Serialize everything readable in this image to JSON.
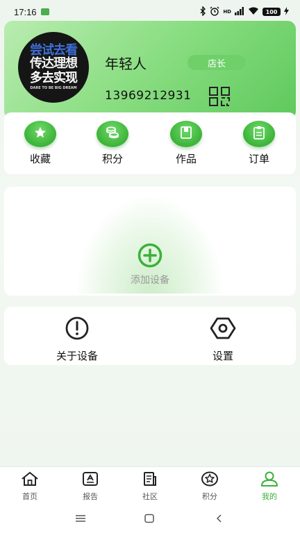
{
  "status_bar": {
    "time": "17:16",
    "network_label": "HD",
    "battery": "100"
  },
  "profile": {
    "avatar_lines": [
      "尝试去看",
      "传达理想",
      "多去实现",
      "DARE TO BE BIG DREAM"
    ],
    "username": "年轻人",
    "role": "店长",
    "phone": "13969212931"
  },
  "quick_actions": [
    {
      "label": "收藏",
      "icon": "star-icon"
    },
    {
      "label": "积分",
      "icon": "coins-icon"
    },
    {
      "label": "作品",
      "icon": "book-icon"
    },
    {
      "label": "订单",
      "icon": "clipboard-icon"
    }
  ],
  "device": {
    "add_label": "添加设备",
    "icon": "plus-circle-icon"
  },
  "tools": [
    {
      "label": "关于设备",
      "icon": "info-icon"
    },
    {
      "label": "设置",
      "icon": "gear-icon"
    }
  ],
  "bottom_nav": [
    {
      "label": "首页",
      "icon": "home-icon",
      "active": false
    },
    {
      "label": "报告",
      "icon": "report-icon",
      "active": false
    },
    {
      "label": "社区",
      "icon": "community-icon",
      "active": false
    },
    {
      "label": "积分",
      "icon": "points-icon",
      "active": false
    },
    {
      "label": "我的",
      "icon": "user-icon",
      "active": true
    }
  ],
  "colors": {
    "accent": "#3bb03a",
    "card_gradient_start": "#b9ecb1",
    "card_gradient_end": "#5fc95c"
  }
}
